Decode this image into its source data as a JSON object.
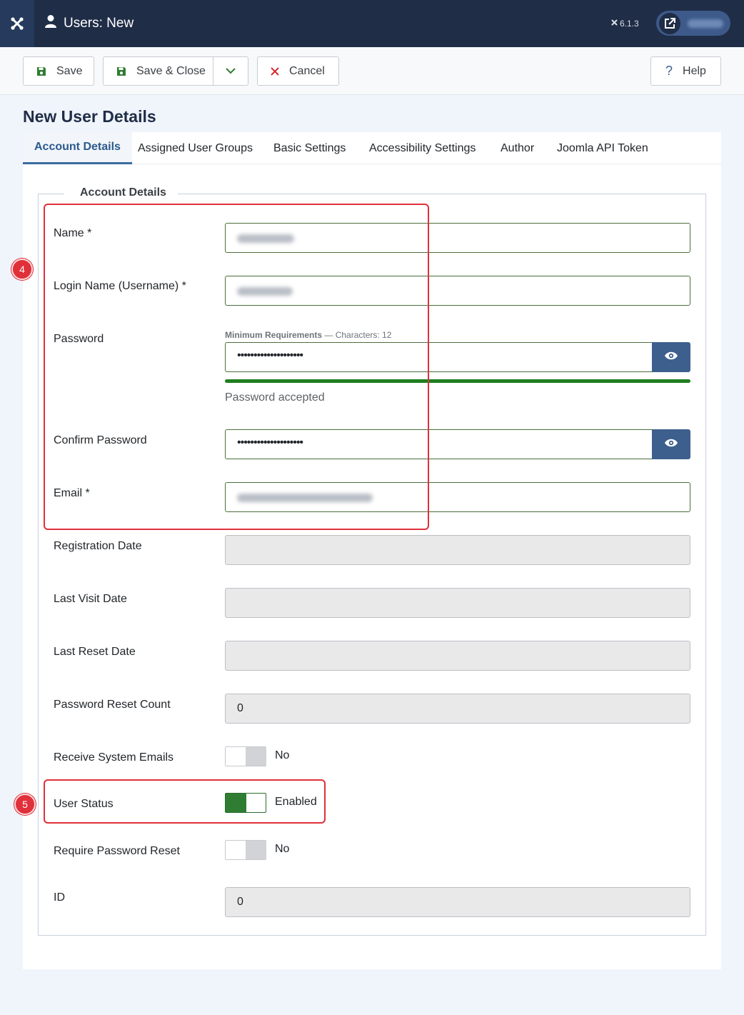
{
  "header": {
    "title": "Users: New",
    "version": "6.1.3",
    "logo_icon": "joomla-logo-icon",
    "user_icon": "user-icon",
    "external_icon": "external-link-icon"
  },
  "toolbar": {
    "save_label": "Save",
    "save_close_label": "Save & Close",
    "cancel_label": "Cancel",
    "help_label": "Help"
  },
  "page_heading": "New User Details",
  "tabs": [
    {
      "label": "Account Details",
      "active": true
    },
    {
      "label": "Assigned User Groups",
      "active": false
    },
    {
      "label": "Basic Settings",
      "active": false
    },
    {
      "label": "Accessibility Settings",
      "active": false
    },
    {
      "label": "Author",
      "active": false
    },
    {
      "label": "Joomla API Token",
      "active": false
    }
  ],
  "form": {
    "legend": "Account Details",
    "name_label": "Name *",
    "username_label": "Login Name (Username) *",
    "password_label": "Password",
    "password_min_req_title": "Minimum Requirements",
    "password_min_req_detail": " — Characters: 12",
    "password_dots": "••••••••••••••••••••",
    "password_strength": 1.0,
    "password_status": "Password accepted",
    "confirm_password_label": "Confirm Password",
    "confirm_password_dots": "••••••••••••••••••••",
    "email_label": "Email *",
    "registration_date_label": "Registration Date",
    "last_visit_label": "Last Visit Date",
    "last_reset_label": "Last Reset Date",
    "reset_count_label": "Password Reset Count",
    "reset_count_value": "0",
    "receive_emails_label": "Receive System Emails",
    "receive_emails_value": "No",
    "user_status_label": "User Status",
    "user_status_value": "Enabled",
    "require_reset_label": "Require Password Reset",
    "require_reset_value": "No",
    "id_label": "ID",
    "id_value": "0"
  },
  "annotations": {
    "badge_fields": "4",
    "badge_status": "5"
  },
  "colors": {
    "header_bg": "#1f2d47",
    "accent": "#3d5f8e",
    "valid_border": "#4b6f3a",
    "strength_fill": "#1e7e1e",
    "annotation_red": "#e0303a"
  }
}
